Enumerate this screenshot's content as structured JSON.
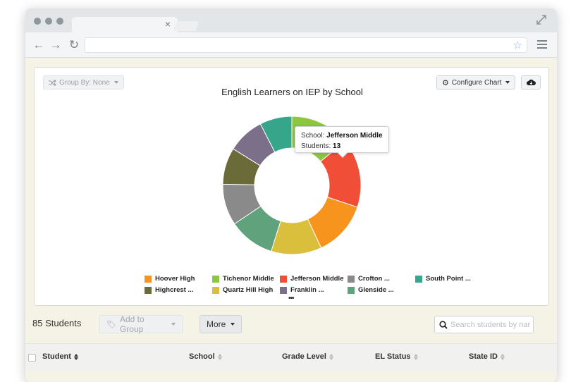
{
  "browser": {
    "url": "",
    "tab_close": "×"
  },
  "chart_card": {
    "group_by_label": "Group By: None",
    "configure_label": "Configure Chart",
    "more_label": "•••"
  },
  "chart_data": {
    "type": "pie",
    "title": "English Learners on IEP by School",
    "categories": [
      "Tichenor Middle",
      "Jefferson Middle",
      "Hoover High",
      "Quartz Hill High",
      "Glenside ...",
      "Crofton ...",
      "Highcrest ...",
      "Franklin ...",
      "South Point ..."
    ],
    "values": [
      13,
      15,
      12,
      11,
      10,
      9,
      8,
      8,
      7
    ],
    "colors": [
      "#8dc63f",
      "#f04e37",
      "#f7941d",
      "#d9bf3b",
      "#5fa27b",
      "#8a8a8a",
      "#6b6b3a",
      "#7b6f8a",
      "#36a58a"
    ],
    "legend": [
      {
        "label": "Hoover High",
        "color": "#f7941d"
      },
      {
        "label": "Tichenor Middle",
        "color": "#8dc63f"
      },
      {
        "label": "Jefferson Middle",
        "color": "#f04e37"
      },
      {
        "label": "Crofton ...",
        "color": "#8a8a8a"
      },
      {
        "label": "South Point ...",
        "color": "#36a58a"
      },
      {
        "label": "Highcrest ...",
        "color": "#6b6b3a"
      },
      {
        "label": "Quartz Hill High",
        "color": "#d9bf3b"
      },
      {
        "label": "Franklin ...",
        "color": "#7b6f8a"
      },
      {
        "label": "Glenside ...",
        "color": "#5fa27b"
      }
    ],
    "legend_placement": "bottom"
  },
  "tooltip": {
    "school_label": "School:",
    "school_value": "Jefferson Middle",
    "students_label": "Students:",
    "students_value": "13"
  },
  "list": {
    "count_label": "85 Students",
    "add_to_group_label": "Add to Group",
    "more_label": "More",
    "search_placeholder": "Search students by nar"
  },
  "table": {
    "columns": [
      "Student",
      "School",
      "Grade Level",
      "EL Status",
      "State ID"
    ]
  }
}
